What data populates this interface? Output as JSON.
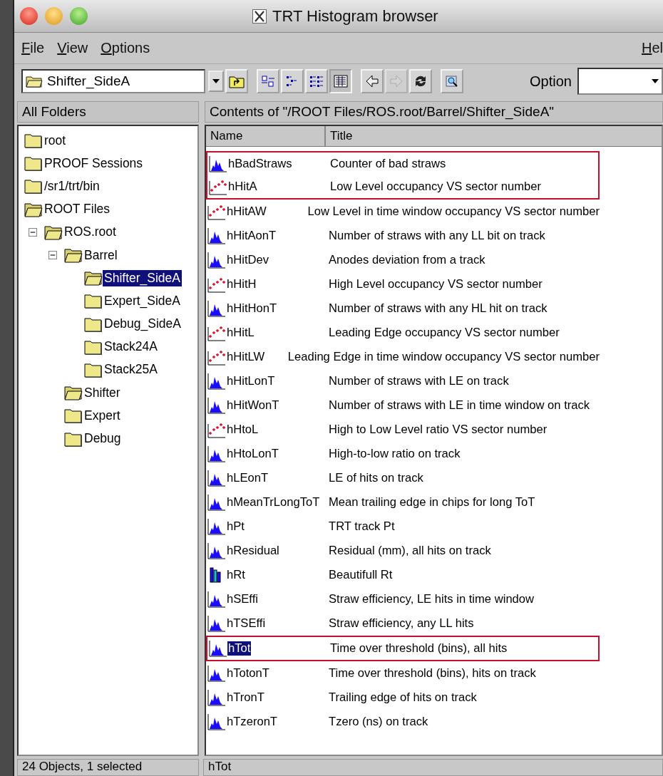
{
  "window": {
    "title": "TRT Histogram browser"
  },
  "menu": [
    {
      "label": "File"
    },
    {
      "label": "View"
    },
    {
      "label": "Options"
    }
  ],
  "help_menu": {
    "label": "Hel"
  },
  "toolbar": {
    "location": "Shifter_SideA",
    "buttons": [
      {
        "kind": "up",
        "pressed": false,
        "disabled": false
      },
      {
        "kind": "large",
        "pressed": false,
        "disabled": false
      },
      {
        "kind": "small",
        "pressed": false,
        "disabled": false
      },
      {
        "kind": "list",
        "pressed": false,
        "disabled": false
      },
      {
        "kind": "details",
        "pressed": true,
        "disabled": false
      },
      {
        "kind": "back",
        "pressed": false,
        "disabled": false
      },
      {
        "kind": "forward",
        "pressed": false,
        "disabled": true
      },
      {
        "kind": "refresh",
        "pressed": false,
        "disabled": false
      },
      {
        "kind": "inspect",
        "pressed": false,
        "disabled": false
      }
    ],
    "option_label": "Option"
  },
  "folders": {
    "header": "All Folders",
    "tree": [
      {
        "label": "root",
        "open": false,
        "expanded": false,
        "selected": false
      },
      {
        "label": "PROOF Sessions",
        "open": false,
        "expanded": false,
        "selected": false
      },
      {
        "label": "/sr1/trt/bin",
        "open": false,
        "expanded": false,
        "selected": false
      },
      {
        "label": "ROOT Files",
        "open": true,
        "expanded": false,
        "selected": false,
        "children": [
          {
            "label": "ROS.root",
            "open": true,
            "expanded": true,
            "selected": false,
            "children": [
              {
                "label": "Barrel",
                "open": true,
                "expanded": true,
                "selected": false,
                "children": [
                  {
                    "label": "Shifter_SideA",
                    "open": true,
                    "expanded": false,
                    "selected": true
                  },
                  {
                    "label": "Expert_SideA",
                    "open": false,
                    "expanded": false,
                    "selected": false
                  },
                  {
                    "label": "Debug_SideA",
                    "open": false,
                    "expanded": false,
                    "selected": false
                  },
                  {
                    "label": "Stack24A",
                    "open": false,
                    "expanded": false,
                    "selected": false
                  },
                  {
                    "label": "Stack25A",
                    "open": false,
                    "expanded": false,
                    "selected": false
                  }
                ]
              },
              {
                "label": "Shifter",
                "open": true,
                "expanded": false,
                "selected": false
              },
              {
                "label": "Expert",
                "open": false,
                "expanded": false,
                "selected": false
              },
              {
                "label": "Debug",
                "open": false,
                "expanded": false,
                "selected": false
              }
            ]
          }
        ]
      }
    ]
  },
  "contents": {
    "header": "Contents of \"/ROOT Files/ROS.root/Barrel/Shifter_SideA\"",
    "columns": [
      "Name",
      "Title"
    ],
    "rows": [
      {
        "kind": "hist",
        "name": "hBadStraws",
        "title": "Counter of bad straws",
        "selected": false,
        "boxed": true
      },
      {
        "kind": "graph",
        "name": "hHitA",
        "title": "Low Level occupancy VS sector number",
        "selected": false,
        "boxed": true
      },
      {
        "kind": "graph",
        "name": "hHitAW",
        "title": "Low Level in time window occupancy VS sector number",
        "selected": false,
        "boxed": false
      },
      {
        "kind": "hist",
        "name": "hHitAonT",
        "title": "Number of straws with any LL bit on track",
        "selected": false,
        "boxed": false
      },
      {
        "kind": "hist",
        "name": "hHitDev",
        "title": "Anodes deviation from a track",
        "selected": false,
        "boxed": false
      },
      {
        "kind": "graph",
        "name": "hHitH",
        "title": "High Level occupancy VS sector number",
        "selected": false,
        "boxed": false
      },
      {
        "kind": "hist",
        "name": "hHitHonT",
        "title": "Number of straws with any HL hit on track",
        "selected": false,
        "boxed": false
      },
      {
        "kind": "graph",
        "name": "hHitL",
        "title": "Leading Edge occupancy VS sector number",
        "selected": false,
        "boxed": false
      },
      {
        "kind": "graph",
        "name": "hHitLW",
        "title": "Leading Edge in time window occupancy VS sector number",
        "selected": false,
        "boxed": false
      },
      {
        "kind": "hist",
        "name": "hHitLonT",
        "title": "Number of straws with LE on track",
        "selected": false,
        "boxed": false
      },
      {
        "kind": "hist",
        "name": "hHitWonT",
        "title": "Number of straws with LE in time window on track",
        "selected": false,
        "boxed": false
      },
      {
        "kind": "graph",
        "name": "hHtoL",
        "title": "High to Low Level ratio VS sector number",
        "selected": false,
        "boxed": false
      },
      {
        "kind": "hist",
        "name": "hHtoLonT",
        "title": "High-to-low ratio on track",
        "selected": false,
        "boxed": false
      },
      {
        "kind": "hist",
        "name": "hLEonT",
        "title": "LE of hits on track",
        "selected": false,
        "boxed": false
      },
      {
        "kind": "hist",
        "name": "hMeanTrLongToT",
        "title": "Mean trailing edge in chips for long ToT",
        "selected": false,
        "boxed": false
      },
      {
        "kind": "hist",
        "name": "hPt",
        "title": "TRT track Pt",
        "selected": false,
        "boxed": false
      },
      {
        "kind": "hist",
        "name": "hResidual",
        "title": "Residual (mm), all hits on track",
        "selected": false,
        "boxed": false
      },
      {
        "kind": "stack",
        "name": "hRt",
        "title": "Beautifull Rt",
        "selected": false,
        "boxed": false
      },
      {
        "kind": "hist",
        "name": "hSEffi",
        "title": "Straw efficiency, LE hits in time window",
        "selected": false,
        "boxed": false
      },
      {
        "kind": "hist",
        "name": "hTSEffi",
        "title": "Straw efficiency, any LL hits",
        "selected": false,
        "boxed": false
      },
      {
        "kind": "hist",
        "name": "hTot",
        "title": "Time over threshold (bins), all hits",
        "selected": true,
        "boxed": true
      },
      {
        "kind": "hist",
        "name": "hTotonT",
        "title": "Time over threshold (bins), hits on track",
        "selected": false,
        "boxed": false
      },
      {
        "kind": "hist",
        "name": "hTronT",
        "title": "Trailing edge of hits on track",
        "selected": false,
        "boxed": false
      },
      {
        "kind": "hist",
        "name": "hTzeronT",
        "title": "Tzero (ns) on track",
        "selected": false,
        "boxed": false
      }
    ]
  },
  "status_bar": [
    "24 Objects, 1 selected",
    "hTot"
  ]
}
